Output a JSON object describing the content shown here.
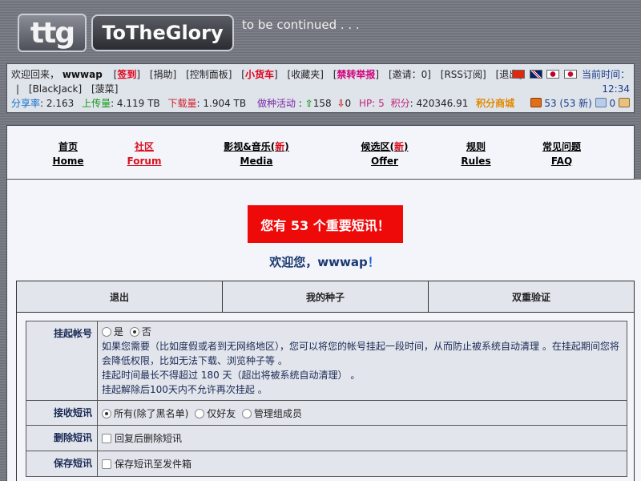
{
  "header": {
    "logo_short": "ttg",
    "logo_full": "ToTheGlory",
    "tagline": "to be continued . . ."
  },
  "infobar": {
    "welcome_prefix": "欢迎回来，",
    "username": "wwwap",
    "links": {
      "signin": "签到",
      "donate": "捐助",
      "control_panel": "控制面板",
      "cart": "小货车",
      "favorites": "收藏夹",
      "report": "禁转举报",
      "invite": "邀请：0",
      "rss": "RSS订阅",
      "logout": "退出",
      "blackjack": "BlackJack",
      "spinach": "菠菜"
    },
    "pipe": "|",
    "current_time_label": "当前时间：",
    "current_time": "12:34",
    "stats": {
      "ratio_label": "分享率",
      "ratio": ": 2.163",
      "upload_label": "上传量",
      "upload": ": 4.119 TB",
      "download_label": "下载量",
      "download": ": 1.904 TB",
      "seeding_label": "做种活动",
      "seeding_prefix": " :",
      "seeding_up": "158",
      "seeding_down": "0",
      "hp_label": "HP:",
      "hp": "5",
      "points_label": "积分",
      "points": ": 420346.91",
      "shop": "积分商城"
    },
    "messages": "53 (53 新)",
    "friends": "0"
  },
  "nav": {
    "items": [
      {
        "cn": "首页",
        "en": "Home"
      },
      {
        "cn": "社区",
        "en": "Forum"
      },
      {
        "cn": "影视&音乐(",
        "new": "新",
        "cn_end": ")",
        "en": "Media"
      },
      {
        "cn": "候选区(",
        "new": "新",
        "cn_end": ")",
        "en": "Offer"
      },
      {
        "cn": "规则",
        "en": "Rules"
      },
      {
        "cn": "常见问题",
        "en": "FAQ"
      }
    ]
  },
  "main": {
    "alert": "您有 53 个重要短讯！",
    "welcome": "欢迎您，wwwap",
    "welcome_bang": "！",
    "tabs": [
      "退出",
      "我的种子",
      "双重验证"
    ],
    "settings": {
      "suspend": {
        "label": "挂起帐号",
        "opt_yes": "是",
        "opt_no": "否",
        "desc1": "如果您需要（比如度假或者到无网络地区），您可以将您的帐号挂起一段时间，从而防止被系统自动清理 。在挂起期间您将会降低权限，比如无法下载、浏览种子等 。",
        "desc2": "挂起时间最长不得超过 180 天（超出将被系统自动清理） 。",
        "desc3": "挂起解除后100天内不允许再次挂起 。"
      },
      "receive": {
        "label": "接收短讯",
        "opt_all": "所有(除了黑名单)",
        "opt_friends": "仅好友",
        "opt_staff": "管理组成员"
      },
      "delete": {
        "label": "删除短讯",
        "opt": "回复后删除短讯"
      },
      "save": {
        "label": "保存短讯",
        "opt": "保存短讯至发件箱"
      }
    }
  }
}
